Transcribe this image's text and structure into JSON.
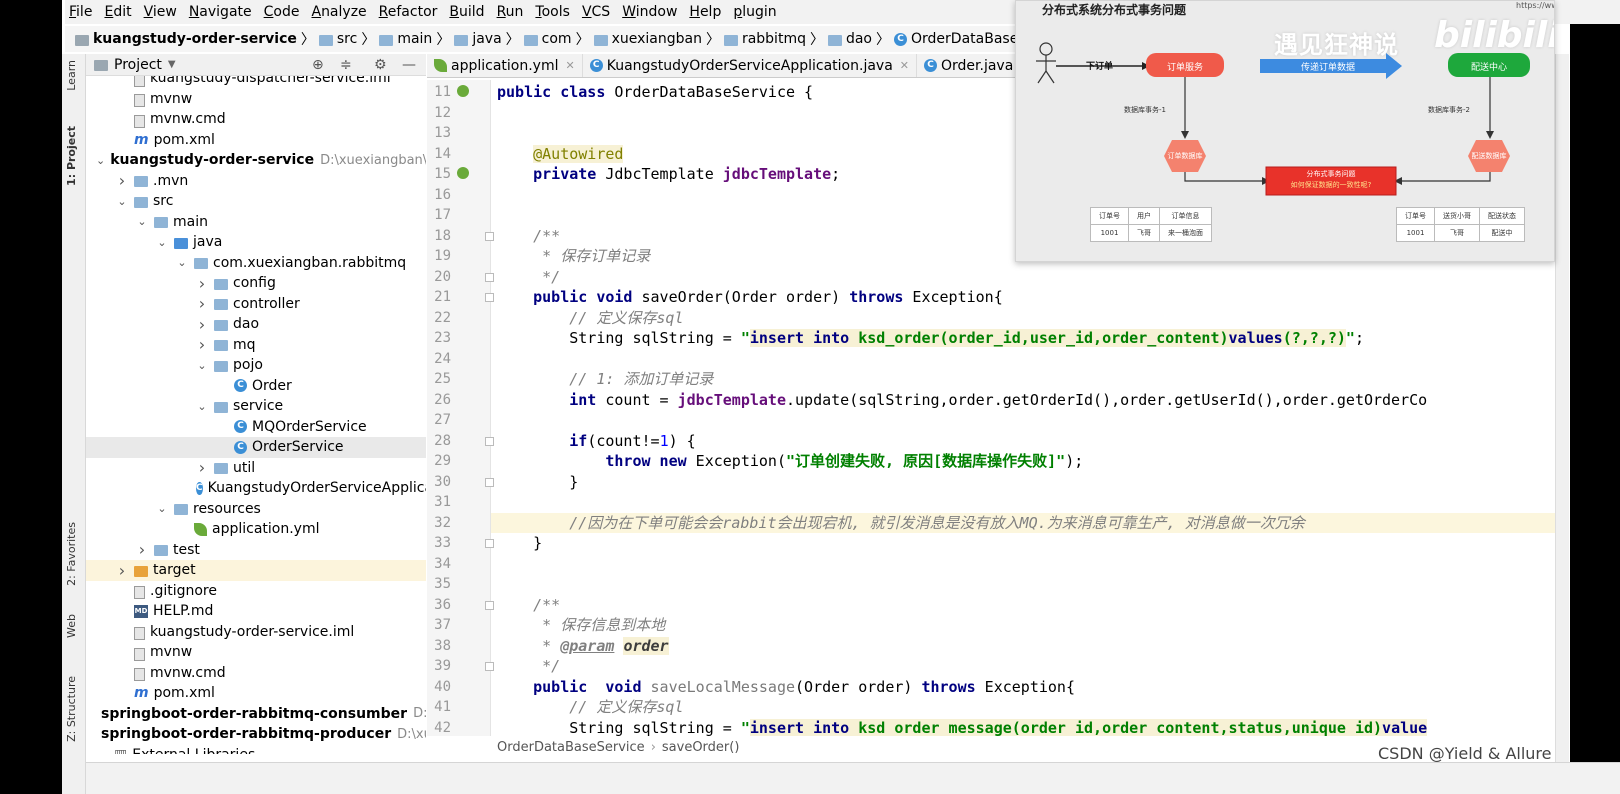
{
  "menu": [
    "File",
    "Edit",
    "View",
    "Navigate",
    "Code",
    "Analyze",
    "Refactor",
    "Build",
    "Run",
    "Tools",
    "VCS",
    "Window",
    "Help",
    "plugin"
  ],
  "breadcrumb": [
    "kuangstudy-order-service",
    "src",
    "main",
    "java",
    "com",
    "xuexiangban",
    "rabbitmq",
    "dao",
    "OrderDataBaseService"
  ],
  "left_strip": {
    "project": "1: Project",
    "learn": "Learn",
    "favorites": "2: Favorites",
    "web": "Web",
    "structure": "Z: Structure"
  },
  "project_panel": {
    "title": "Project",
    "tree": [
      {
        "label": "kuangstudy-dispatcher-service.iml",
        "indent": 1,
        "icon": "file",
        "arrow": ""
      },
      {
        "label": "mvnw",
        "indent": 1,
        "icon": "file",
        "arrow": ""
      },
      {
        "label": "mvnw.cmd",
        "indent": 1,
        "icon": "file",
        "arrow": ""
      },
      {
        "label": "pom.xml",
        "indent": 1,
        "icon": "maven",
        "arrow": ""
      },
      {
        "label": "kuangstudy-order-service",
        "indent": 0,
        "icon": "module",
        "arrow": "open",
        "bold": true,
        "path": "D:\\xuexiangban\\course"
      },
      {
        "label": ".mvn",
        "indent": 1,
        "icon": "folder",
        "arrow": "closed"
      },
      {
        "label": "src",
        "indent": 1,
        "icon": "folder",
        "arrow": "open"
      },
      {
        "label": "main",
        "indent": 2,
        "icon": "folder",
        "arrow": "open"
      },
      {
        "label": "java",
        "indent": 3,
        "icon": "folder-blue",
        "arrow": "open"
      },
      {
        "label": "com.xuexiangban.rabbitmq",
        "indent": 4,
        "icon": "folder",
        "arrow": "open"
      },
      {
        "label": "config",
        "indent": 5,
        "icon": "folder",
        "arrow": "closed"
      },
      {
        "label": "controller",
        "indent": 5,
        "icon": "folder",
        "arrow": "closed"
      },
      {
        "label": "dao",
        "indent": 5,
        "icon": "folder",
        "arrow": "closed"
      },
      {
        "label": "mq",
        "indent": 5,
        "icon": "folder",
        "arrow": "closed"
      },
      {
        "label": "pojo",
        "indent": 5,
        "icon": "folder",
        "arrow": "open"
      },
      {
        "label": "Order",
        "indent": 6,
        "icon": "class",
        "arrow": ""
      },
      {
        "label": "service",
        "indent": 5,
        "icon": "folder",
        "arrow": "open"
      },
      {
        "label": "MQOrderService",
        "indent": 6,
        "icon": "class",
        "arrow": ""
      },
      {
        "label": "OrderService",
        "indent": 6,
        "icon": "class",
        "arrow": "",
        "selected": true
      },
      {
        "label": "util",
        "indent": 5,
        "icon": "folder",
        "arrow": "closed"
      },
      {
        "label": "KuangstudyOrderServiceApplication",
        "indent": 5,
        "icon": "class",
        "arrow": ""
      },
      {
        "label": "resources",
        "indent": 3,
        "icon": "folder",
        "arrow": "open"
      },
      {
        "label": "application.yml",
        "indent": 4,
        "icon": "yml",
        "arrow": ""
      },
      {
        "label": "test",
        "indent": 2,
        "icon": "folder",
        "arrow": "closed"
      },
      {
        "label": "target",
        "indent": 1,
        "icon": "folder-orange",
        "arrow": "closed",
        "highlight": true
      },
      {
        "label": ".gitignore",
        "indent": 1,
        "icon": "file",
        "arrow": ""
      },
      {
        "label": "HELP.md",
        "indent": 1,
        "icon": "md",
        "arrow": ""
      },
      {
        "label": "kuangstudy-order-service.iml",
        "indent": 1,
        "icon": "file",
        "arrow": ""
      },
      {
        "label": "mvnw",
        "indent": 1,
        "icon": "file",
        "arrow": ""
      },
      {
        "label": "mvnw.cmd",
        "indent": 1,
        "icon": "file",
        "arrow": ""
      },
      {
        "label": "pom.xml",
        "indent": 1,
        "icon": "maven",
        "arrow": ""
      },
      {
        "label": "springboot-order-rabbitmq-consumber",
        "indent": 0,
        "icon": "module",
        "arrow": "",
        "bold": true,
        "path": "D:\\xuex"
      },
      {
        "label": "springboot-order-rabbitmq-producer",
        "indent": 0,
        "icon": "module",
        "arrow": "",
        "bold": true,
        "path": "D:\\xuexian"
      },
      {
        "label": "External Libraries",
        "indent": 0,
        "icon": "lib",
        "arrow": ""
      }
    ]
  },
  "tabs": [
    {
      "label": "application.yml",
      "icon": "yml"
    },
    {
      "label": "KuangstudyOrderServiceApplication.java",
      "icon": "class"
    },
    {
      "label": "Order.java",
      "icon": "class"
    },
    {
      "label": "Order",
      "icon": "class"
    }
  ],
  "editor": {
    "lines": [
      {
        "n": "11",
        "html": "<span class=\"kw\">public class</span> OrderDataBaseService {"
      },
      {
        "n": "12",
        "html": ""
      },
      {
        "n": "13",
        "html": ""
      },
      {
        "n": "14",
        "html": "    <span class=\"ann\">@Autowired</span>"
      },
      {
        "n": "15",
        "html": "    <span class=\"kw\">private</span> JdbcTemplate <span class=\"fld\">jdbcTemplate</span>;"
      },
      {
        "n": "16",
        "html": ""
      },
      {
        "n": "17",
        "html": ""
      },
      {
        "n": "18",
        "html": "    <span class=\"cmt\">/**</span>"
      },
      {
        "n": "19",
        "html": "<span class=\"cmt\">     * 保存订单记录</span>"
      },
      {
        "n": "20",
        "html": "<span class=\"cmt\">     */</span>"
      },
      {
        "n": "21",
        "html": "    <span class=\"kw\">public void</span> saveOrder(Order order) <span class=\"kw\">throws</span> Exception{"
      },
      {
        "n": "22",
        "html": "        <span class=\"cmt\">// 定义保存sql</span>"
      },
      {
        "n": "23",
        "html": "        String sqlString = <span class=\"str\">\"<span class=\"sql\"><span class=\"kw\">insert into</span> ksd_order(order_id,user_id,order_content)<span class=\"kw\">values</span>(?,?,?)</span>\"</span>;"
      },
      {
        "n": "24",
        "html": ""
      },
      {
        "n": "25",
        "html": "        <span class=\"cmt\">// 1: 添加订单记录</span>"
      },
      {
        "n": "26",
        "html": "        <span class=\"kw\">int</span> count = <span class=\"fld\">jdbcTemplate</span>.update(sqlString,order.getOrderId(),order.getUserId(),order.getOrderCo"
      },
      {
        "n": "27",
        "html": ""
      },
      {
        "n": "28",
        "html": "        <span class=\"kw\">if</span>(count!=<span class=\"num\">1</span>) {"
      },
      {
        "n": "29",
        "html": "            <span class=\"kw\">throw new</span> Exception(<span class=\"str\">\"订单创建失败, 原因[数据库操作失败]\"</span>);"
      },
      {
        "n": "30",
        "html": "        }"
      },
      {
        "n": "31",
        "html": ""
      },
      {
        "n": "32",
        "html": "        <span class=\"cmt\">//因为在下单可能会会rabbit会出现宕机, 就引发消息是没有放入MQ.为来消息可靠生产, 对消息做一次冗余</span>"
      },
      {
        "n": "33",
        "html": "    }"
      },
      {
        "n": "34",
        "html": ""
      },
      {
        "n": "35",
        "html": ""
      },
      {
        "n": "36",
        "html": "    <span class=\"cmt\">/**</span>"
      },
      {
        "n": "37",
        "html": "<span class=\"cmt\">     * 保存信息到本地</span>"
      },
      {
        "n": "38",
        "html": "<span class=\"cmt\">     * </span><span class=\"tag\">@param</span> <span class=\"tagp\">order</span>"
      },
      {
        "n": "39",
        "html": "<span class=\"cmt\">     */</span>"
      },
      {
        "n": "40",
        "html": "    <span class=\"kw\">public  void</span> <span class=\"meth\">saveLocalMessage</span>(Order order) <span class=\"kw\">throws</span> Exception{"
      },
      {
        "n": "41",
        "html": "        <span class=\"cmt\">// 定义保存sql</span>"
      },
      {
        "n": "42",
        "html": "        String sqlString = <span class=\"str\">\"<span class=\"sql\"><span class=\"kw\">insert into</span> ksd order message(order id,order content,status,unique id)<span class=\"kw\">value</span></span></span>"
      }
    ],
    "highlight_line": "32",
    "breadcrumb": [
      "OrderDataBaseService",
      "saveOrder()"
    ]
  },
  "overlay": {
    "title": "分布式系统分布式事务问题",
    "url": "https://www.",
    "brand": "遇见狂神说",
    "logo": "bilibili",
    "actor_label": "下订单",
    "order_service": "订单服务",
    "arrow_label": "传递订单数据",
    "dispatch_center": "配送中心",
    "tx1": "数据库事务-1",
    "tx2": "数据库事务-2",
    "order_db": "订单数据库",
    "dispatch_db": "配送数据库",
    "problem_line1": "分布式事务问题",
    "problem_line2": "如何保证数据的一致性呢?",
    "table1": {
      "headers": [
        "订单号",
        "用户",
        "订单信息"
      ],
      "row": [
        "1001",
        "飞哥",
        "来一桶泡面"
      ]
    },
    "table2": {
      "headers": [
        "订单号",
        "送货小哥",
        "配送状态"
      ],
      "row": [
        "1001",
        "飞哥",
        "配送中"
      ]
    }
  },
  "watermark": "CSDN @Yield & Allure",
  "colors": {
    "keyword": "#000080",
    "string": "#008000",
    "comment": "#808080",
    "field": "#660e7a",
    "service_red": "#f05a4a",
    "center_green": "#1ea83c",
    "arrow_blue": "#3d8be0"
  }
}
